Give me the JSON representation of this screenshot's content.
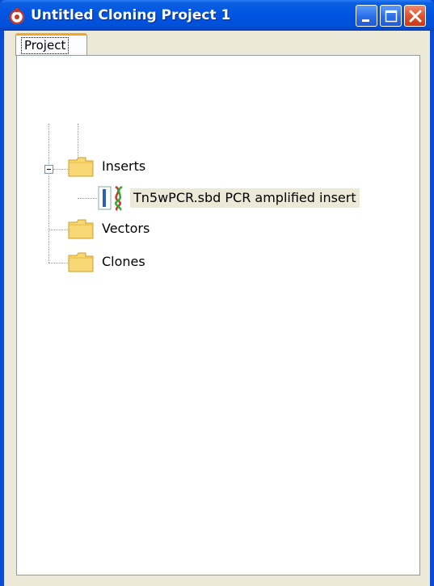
{
  "window": {
    "title": "Untitled Cloning Project 1"
  },
  "tabs": [
    {
      "label": "Project"
    }
  ],
  "tree": {
    "folders": [
      {
        "label": "Inserts",
        "icon": "folder-icon",
        "expanded": true,
        "children": [
          {
            "label": "Tn5wPCR.sbd PCR amplified insert",
            "icon": "sequence-file-icon"
          }
        ]
      },
      {
        "label": "Vectors",
        "icon": "folder-icon"
      },
      {
        "label": "Clones",
        "icon": "folder-icon"
      }
    ]
  },
  "colors": {
    "titlebar": "#0054e3",
    "tab_highlight": "#f5a623",
    "selection": "#ece9d8"
  }
}
